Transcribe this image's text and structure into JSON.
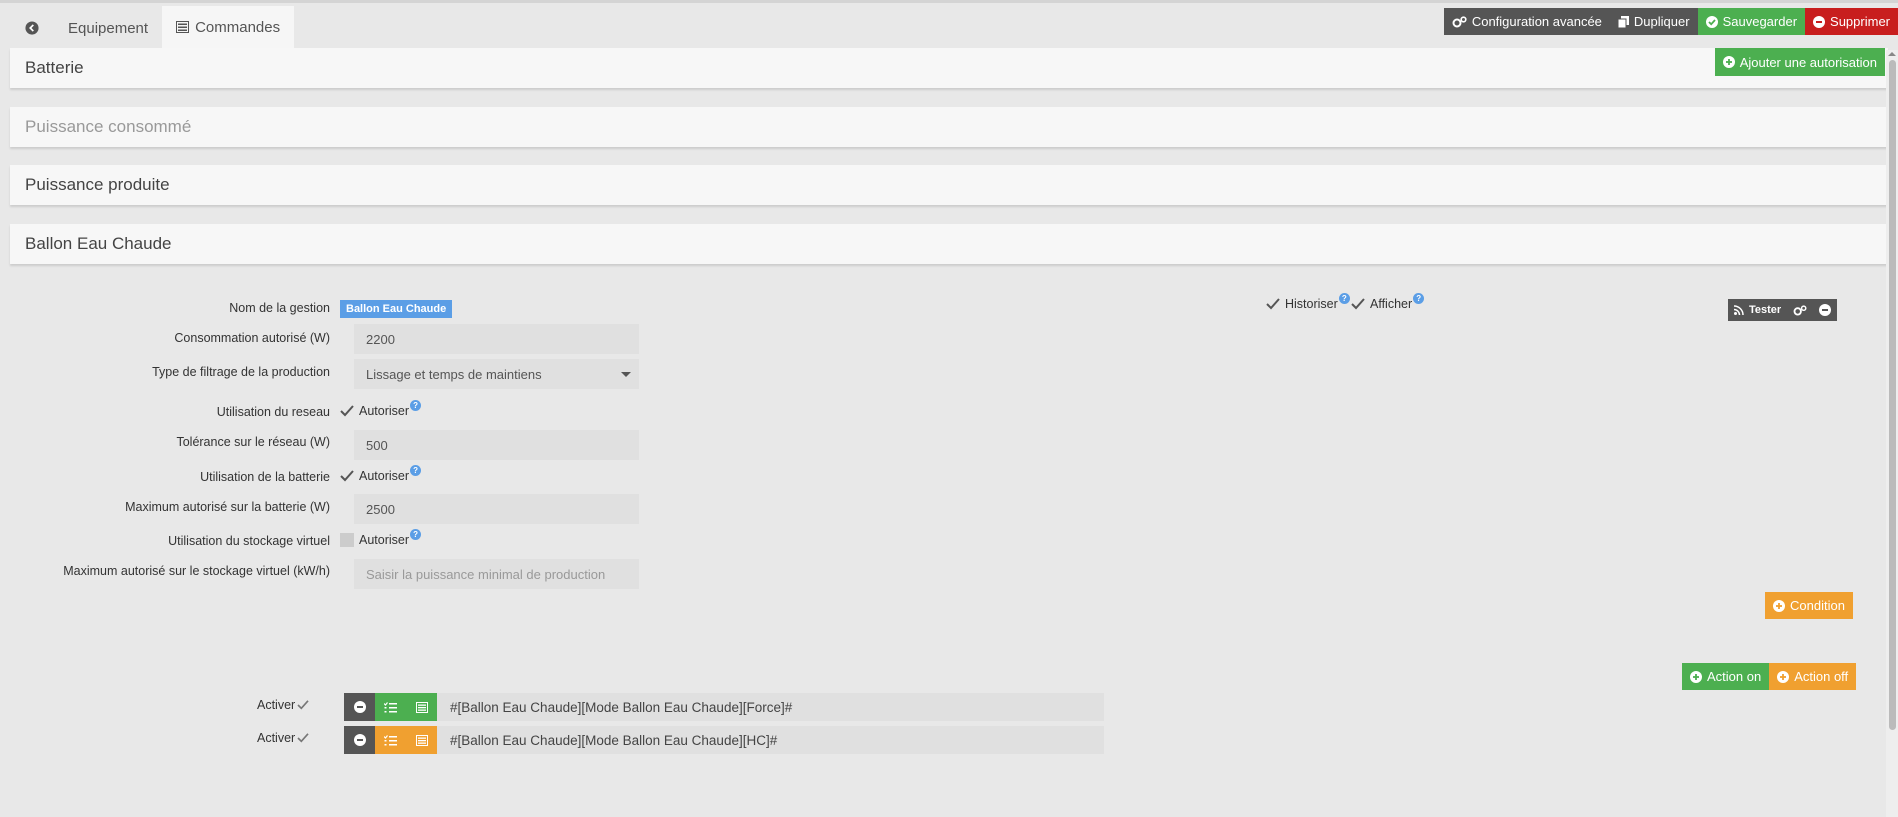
{
  "tabs": {
    "equipement": "Equipement",
    "commandes": "Commandes"
  },
  "toolbar": {
    "config": "Configuration avancée",
    "dupliquer": "Dupliquer",
    "sauvegarder": "Sauvegarder",
    "supprimer": "Supprimer"
  },
  "add_auth": "Ajouter une autorisation",
  "panels": {
    "batterie": "Batterie",
    "puissance_consomme": "Puissance consommé",
    "puissance_produite": "Puissance produite",
    "ballon": "Ballon Eau Chaude"
  },
  "gestion": {
    "nom_label": "Nom de la gestion",
    "nom_value": "Ballon Eau Chaude",
    "conso_label": "Consommation autorisé (W)",
    "conso_value": "2200",
    "filtrage_label": "Type de filtrage de la production",
    "filtrage_value": "Lissage et temps de maintiens",
    "reseau_label": "Utilisation du reseau",
    "reseau_chk": "Autoriser",
    "tolerance_label": "Tolérance sur le réseau (W)",
    "tolerance_value": "500",
    "batterie_label": "Utilisation de la batterie",
    "batterie_chk": "Autoriser",
    "max_batterie_label": "Maximum autorisé sur la batterie (W)",
    "max_batterie_value": "2500",
    "stockage_label": "Utilisation du stockage virtuel",
    "stockage_chk": "Autoriser",
    "max_stockage_label": "Maximum autorisé sur le stockage virtuel (kW/h)",
    "max_stockage_placeholder": "Saisir la puissance minimal de production",
    "historiser": "Historiser",
    "afficher": "Afficher",
    "tester": "Tester"
  },
  "buttons": {
    "condition": "Condition",
    "action_on": "Action on",
    "action_off": "Action off"
  },
  "actions": [
    {
      "label": "Activer",
      "cmd": "#[Ballon Eau Chaude][Mode Ballon Eau Chaude][Force]#"
    },
    {
      "label": "Activer",
      "cmd": "#[Ballon Eau Chaude][Mode Ballon Eau Chaude][HC]#"
    }
  ],
  "colors": {
    "green": "#4caf50",
    "orange": "#f0a030",
    "red": "#c81e1e",
    "dark": "#555555",
    "blue": "#5b9ee6"
  }
}
